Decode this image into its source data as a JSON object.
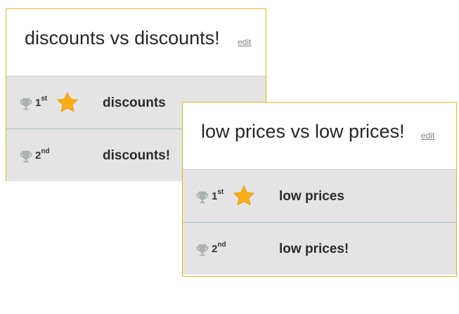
{
  "cards": [
    {
      "title": "discounts vs discounts!",
      "edit_label": "edit",
      "rows": [
        {
          "place_num": "1",
          "place_suffix": "st",
          "answer": "discounts",
          "starred": true
        },
        {
          "place_num": "2",
          "place_suffix": "nd",
          "answer": "discounts!",
          "starred": false
        }
      ]
    },
    {
      "title": "low prices vs low prices!",
      "edit_label": "edit",
      "rows": [
        {
          "place_num": "1",
          "place_suffix": "st",
          "answer": "low prices",
          "starred": true
        },
        {
          "place_num": "2",
          "place_suffix": "nd",
          "answer": "low prices!",
          "starred": false
        }
      ]
    }
  ],
  "icons": {
    "trophy": "trophy-icon",
    "star": "star-icon"
  },
  "colors": {
    "card_border": "#e8b41c",
    "row_bg": "#e4e4e4",
    "star": "#f7ae17",
    "trophy": "#a9b1b3"
  }
}
